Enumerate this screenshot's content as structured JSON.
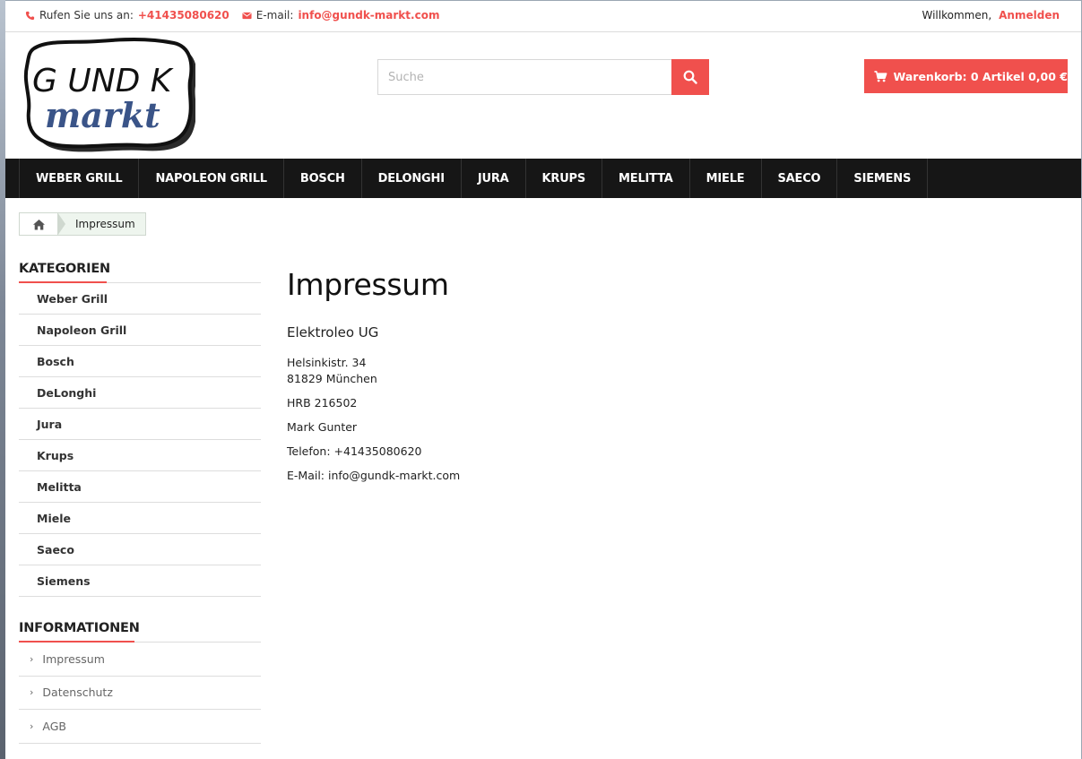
{
  "topbar": {
    "phone_prefix": "Rufen Sie uns an:",
    "phone": "+41435080620",
    "email_prefix": "E-mail:",
    "email": "info@gundk-markt.com",
    "welcome": "Willkommen,",
    "login": "Anmelden"
  },
  "logo": {
    "line1": "G UND K",
    "line2": "markt"
  },
  "search": {
    "placeholder": "Suche",
    "icon": "search-icon"
  },
  "cart": {
    "label": "Warenkorb: 0 Artikel 0,00 €",
    "icon": "cart-icon"
  },
  "nav": {
    "items": [
      "WEBER GRILL",
      "NAPOLEON GRILL",
      "BOSCH",
      "DELONGHI",
      "JURA",
      "KRUPS",
      "MELITTA",
      "MIELE",
      "SAECO",
      "SIEMENS"
    ]
  },
  "breadcrumb": {
    "home_icon": "home-icon",
    "current": "Impressum"
  },
  "sidebar": {
    "categories_title": "KATEGORIEN",
    "categories": [
      "Weber Grill",
      "Napoleon Grill",
      "Bosch",
      "DeLonghi",
      "Jura",
      "Krups",
      "Melitta",
      "Miele",
      "Saeco",
      "Siemens"
    ],
    "info_title": "INFORMATIONEN",
    "info": [
      "Impressum",
      "Datenschutz",
      "AGB"
    ]
  },
  "main": {
    "title": "Impressum",
    "company": "Elektroleo UG",
    "street": "Helsinkistr. 34",
    "city": "81829 München",
    "hrb": "HRB 216502",
    "person": "Mark Gunter",
    "phone": "Telefon: +41435080620",
    "email": "E-Mail: info@gundk-markt.com"
  },
  "colors": {
    "accent": "#f0504d",
    "nav_bg": "#161616",
    "logo_blue": "#3a5488"
  }
}
